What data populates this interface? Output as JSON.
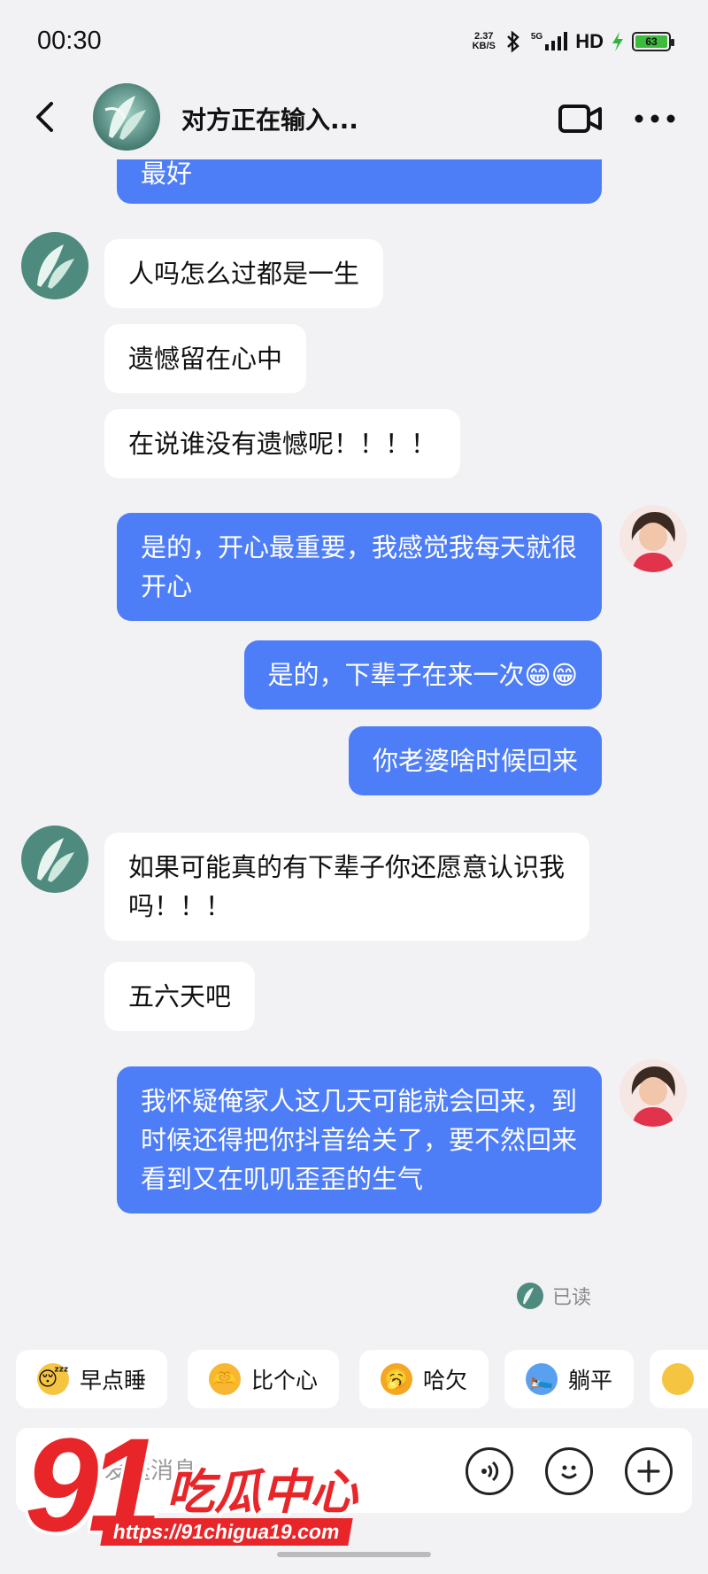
{
  "status_bar": {
    "time": "00:30",
    "net_speed_value": "2.37",
    "net_speed_unit": "KB/S",
    "network": "5G",
    "hd": "HD",
    "battery": "63"
  },
  "header": {
    "title": "对方正在输入..."
  },
  "messages": {
    "m0": "最好",
    "m1": "人吗怎么过都是一生",
    "m2": "遗憾留在心中",
    "m3": "在说谁没有遗憾呢！！！！",
    "m4": "是的，开心最重要，我感觉我每天就很开心",
    "m5": "是的，下辈子在来一次😁😁",
    "m6": "你老婆啥时候回来",
    "m7": "如果可能真的有下辈子你还愿意认识我吗！！！",
    "m8": "五六天吧",
    "m9": "我怀疑俺家人这几天可能就会回来，到时候还得把你抖音给关了，要不然回来看到又在叽叽歪歪的生气"
  },
  "read_status": "已读",
  "quick_replies": [
    {
      "label": "早点睡",
      "icon": "sleepy-face-icon",
      "emoji": "😴",
      "color": "#f5c542"
    },
    {
      "label": "比个心",
      "icon": "heart-hands-icon",
      "emoji": "🫶",
      "color": "#f7b733"
    },
    {
      "label": "哈欠",
      "icon": "yawn-face-icon",
      "emoji": "🥱",
      "color": "#f5a623"
    },
    {
      "label": "躺平",
      "icon": "lying-flat-icon",
      "emoji": "🛌",
      "color": "#5aa0f0"
    }
  ],
  "input": {
    "placeholder": "发送消息"
  },
  "watermark": {
    "number": "91",
    "brand": "吃瓜中心",
    "url": "https://91chigua19.com"
  },
  "colors": {
    "outgoing_bubble": "#4e7df8",
    "incoming_bubble": "#ffffff",
    "background": "#f2f2f5",
    "watermark": "#e8262a"
  }
}
